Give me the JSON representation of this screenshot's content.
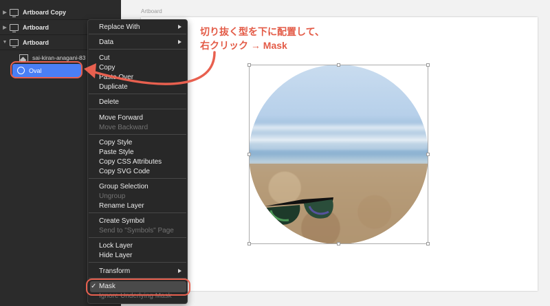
{
  "layers": {
    "artboards": [
      {
        "name": "Artboard Copy"
      },
      {
        "name": "Artboard"
      },
      {
        "name": "Artboard"
      }
    ],
    "image_layer": "sai-kiran-anagani-83",
    "oval_layer": "Oval"
  },
  "canvas": {
    "artboard_label": "Artboard"
  },
  "menu": {
    "replace_with": "Replace With",
    "data": "Data",
    "cut": "Cut",
    "copy": "Copy",
    "paste_over": "Paste Over",
    "duplicate": "Duplicate",
    "delete": "Delete",
    "move_forward": "Move Forward",
    "move_backward": "Move Backward",
    "copy_style": "Copy Style",
    "paste_style": "Paste Style",
    "copy_css": "Copy CSS Attributes",
    "copy_svg": "Copy SVG Code",
    "group_selection": "Group Selection",
    "ungroup": "Ungroup",
    "rename_layer": "Rename Layer",
    "create_symbol": "Create Symbol",
    "send_to_symbols": "Send to \"Symbols\" Page",
    "lock_layer": "Lock Layer",
    "hide_layer": "Hide Layer",
    "transform": "Transform",
    "mask_check": "✓",
    "mask": "Mask",
    "ignore_underlying_mask": "Ignore Underlying Mask"
  },
  "annotation": {
    "line1": "切り抜く型を下に配置して、",
    "line2": "右クリック → Mask"
  },
  "colors": {
    "accent": "#e8604f",
    "selection": "#4a7ff5"
  }
}
